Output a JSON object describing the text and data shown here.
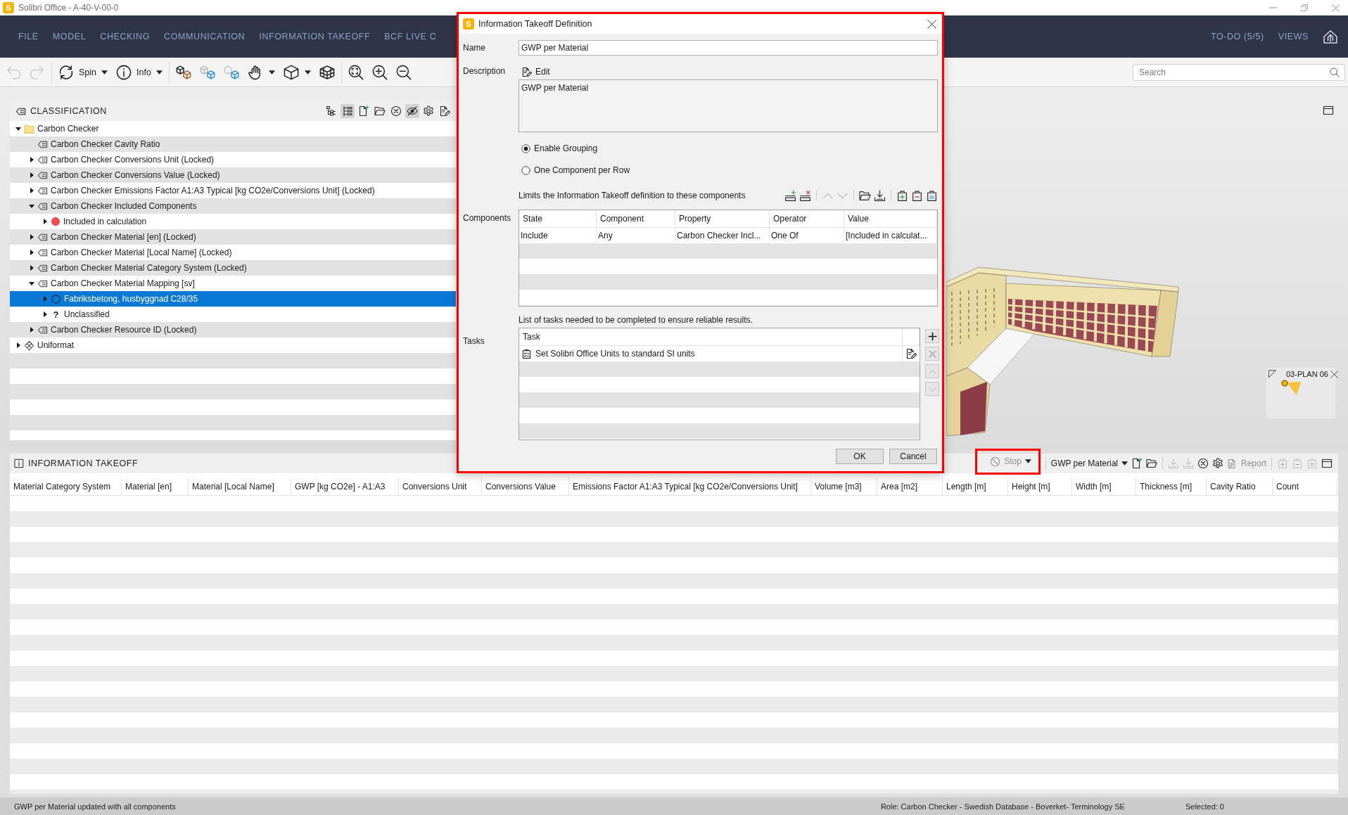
{
  "window": {
    "logo": "S",
    "title": "Solibri Office - A-40-V-00-0"
  },
  "menu": {
    "items": [
      "FILE",
      "MODEL",
      "CHECKING",
      "COMMUNICATION",
      "INFORMATION TAKEOFF",
      "BCF LIVE C"
    ],
    "right_items": [
      "TO-DO (5/5)",
      "VIEWS"
    ]
  },
  "toolbar": {
    "groups": [
      [
        {
          "kind": "undo",
          "disabled": true,
          "dropdown": false
        },
        {
          "kind": "redo",
          "disabled": true,
          "dropdown": false
        }
      ],
      [
        {
          "kind": "spin",
          "label": "Spin",
          "disabled": false,
          "dropdown": true
        },
        {
          "kind": "info",
          "label": "Info",
          "disabled": false,
          "dropdown": true
        }
      ],
      [
        {
          "kind": "components",
          "disabled": false,
          "dropdown": false
        },
        {
          "kind": "transparent",
          "disabled": false,
          "dropdown": false
        },
        {
          "kind": "hidden",
          "disabled": false,
          "dropdown": false
        },
        {
          "kind": "hand",
          "disabled": false,
          "dropdown": true
        },
        {
          "kind": "cube",
          "disabled": false,
          "dropdown": true
        },
        {
          "kind": "section",
          "disabled": false,
          "dropdown": false
        }
      ],
      [
        {
          "kind": "zoom-fit",
          "disabled": false,
          "dropdown": false
        },
        {
          "kind": "zoom-in",
          "disabled": false,
          "dropdown": false
        },
        {
          "kind": "zoom-out",
          "disabled": false,
          "dropdown": false
        }
      ]
    ],
    "search": {
      "placeholder": "Search"
    }
  },
  "classification": {
    "title": "CLASSIFICATION",
    "tools": [
      {
        "kind": "hierarchy",
        "pressed": false
      },
      {
        "kind": "tree",
        "pressed": true
      },
      {
        "kind": "new",
        "pressed": false
      },
      {
        "kind": "open",
        "pressed": false
      },
      {
        "kind": "clear",
        "pressed": false
      },
      {
        "kind": "hide",
        "pressed": true
      },
      {
        "kind": "settings",
        "pressed": false
      },
      {
        "kind": "edit",
        "pressed": false
      }
    ],
    "tree": [
      {
        "label": "Carbon Checker",
        "kind": "folder",
        "expanded": true,
        "selected": false,
        "children": [
          {
            "label": "Carbon Checker Cavity Ratio",
            "kind": "classification",
            "selected": false
          },
          {
            "label": "Carbon Checker Conversions Unit (Locked)",
            "kind": "classification",
            "expanded": false,
            "selected": false
          },
          {
            "label": "Carbon Checker Conversions Value (Locked)",
            "kind": "classification",
            "expanded": false,
            "selected": false
          },
          {
            "label": "Carbon Checker Emissions Factor A1:A3 Typical [kg CO2e/Conversions Unit] (Locked)",
            "kind": "classification",
            "expanded": false,
            "selected": false
          },
          {
            "label": "Carbon Checker Included Components",
            "kind": "classification",
            "expanded": true,
            "selected": false,
            "children": [
              {
                "label": "Included in calculation",
                "kind": "dot",
                "color": "#ee4d4d",
                "expanded": false,
                "selected": false
              }
            ]
          },
          {
            "label": "Carbon Checker Material [en] (Locked)",
            "kind": "classification",
            "expanded": false,
            "selected": false
          },
          {
            "label": "Carbon Checker Material [Local Name] (Locked)",
            "kind": "classification",
            "expanded": false,
            "selected": false
          },
          {
            "label": "Carbon Checker Material Category System (Locked)",
            "kind": "classification",
            "expanded": false,
            "selected": false
          },
          {
            "label": "Carbon Checker Material Mapping [sv]",
            "kind": "classification",
            "expanded": true,
            "selected": false,
            "children": [
              {
                "label": "Fabriksbetong, husbyggnad C28/35",
                "kind": "ring",
                "expanded": false,
                "selected": true
              },
              {
                "label": "Unclassified",
                "kind": "unknown",
                "symbol": "?",
                "expanded": false,
                "selected": false
              }
            ]
          },
          {
            "label": "Carbon Checker Resource ID (Locked)",
            "kind": "classification",
            "expanded": false,
            "selected": false
          }
        ]
      },
      {
        "label": "Uniformat",
        "kind": "standard",
        "expanded": false,
        "selected": false
      }
    ]
  },
  "model_view": {
    "plan": {
      "label": "03-PLAN 06"
    }
  },
  "takeoff": {
    "title": "INFORMATION TAKEOFF",
    "groups": [
      [
        {
          "kind": "stop",
          "label": "Stop",
          "dropdown": true,
          "disabled": true,
          "highlighted": true
        }
      ],
      [
        {
          "kind": "definition",
          "label": "GWP per Material",
          "dropdown": true,
          "disabled": false,
          "highlighted": false
        },
        {
          "kind": "new",
          "dropdown": false,
          "disabled": false,
          "highlighted": false
        },
        {
          "kind": "open",
          "dropdown": false,
          "disabled": false,
          "highlighted": false
        }
      ],
      [
        {
          "kind": "export",
          "dropdown": false,
          "disabled": true,
          "highlighted": false
        },
        {
          "kind": "export-all",
          "dropdown": false,
          "disabled": true,
          "highlighted": false
        },
        {
          "kind": "clear",
          "dropdown": false,
          "disabled": false,
          "highlighted": false
        },
        {
          "kind": "settings",
          "dropdown": false,
          "disabled": false,
          "highlighted": false
        },
        {
          "kind": "report",
          "label": "Report",
          "dropdown": false,
          "disabled": true,
          "highlighted": false
        }
      ],
      [
        {
          "kind": "clipboard-add",
          "dropdown": false,
          "disabled": true,
          "highlighted": false
        },
        {
          "kind": "clipboard-remove",
          "dropdown": false,
          "disabled": true,
          "highlighted": false
        },
        {
          "kind": "clipboard",
          "dropdown": false,
          "disabled": true,
          "highlighted": false
        },
        {
          "kind": "window",
          "dropdown": false,
          "disabled": false,
          "highlighted": false
        }
      ]
    ],
    "columns": [
      "Material Category System",
      "Material [en]",
      "Material [Local Name]",
      "GWP [kg CO2e] - A1:A3",
      "Conversions Unit",
      "Conversions Value",
      "Emissions Factor A1:A3 Typical [kg CO2e/Conversions Unit]",
      "Volume [m3]",
      "Area [m2]",
      "Length [m]",
      "Height [m]",
      "Width [m]",
      "Thickness [m]",
      "Cavity Ratio",
      "Count"
    ]
  },
  "dialog": {
    "logo": "S",
    "title": "Information Takeoff Definition",
    "highlighted": true,
    "name": {
      "label": "Name",
      "value": "GWP per Material"
    },
    "description": {
      "label": "Description",
      "edit": "Edit",
      "value": "GWP per Material"
    },
    "grouping": [
      {
        "label": "Enable Grouping",
        "selected": true
      },
      {
        "label": "One Component per Row",
        "selected": false
      }
    ],
    "components": {
      "label": "Components",
      "hint": "Limits the Information Takeoff definition to these components",
      "tools": [
        [
          {
            "kind": "add-row",
            "disabled": false
          },
          {
            "kind": "remove-row",
            "disabled": false
          }
        ],
        [
          {
            "kind": "up",
            "disabled": true
          },
          {
            "kind": "down",
            "disabled": true
          }
        ],
        [
          {
            "kind": "open",
            "disabled": false
          },
          {
            "kind": "export",
            "disabled": false
          }
        ],
        [
          {
            "kind": "clipboard-add",
            "disabled": false
          },
          {
            "kind": "clipboard-remove",
            "disabled": false
          },
          {
            "kind": "clipboard",
            "disabled": false
          }
        ]
      ],
      "columns": [
        "State",
        "Component",
        "Property",
        "Operator",
        "Value"
      ],
      "rows": [
        [
          "Include",
          "Any",
          "Carbon Checker Incl...",
          "One Of",
          "[Included in calculat..."
        ]
      ]
    },
    "tasks": {
      "label": "Tasks",
      "hint": "List of tasks needed to be completed to ensure reliable results.",
      "columns": [
        "Task"
      ],
      "rows": [
        {
          "text": "Set Solibri Office Units to standard SI units"
        }
      ],
      "tools": [
        {
          "kind": "add",
          "disabled": false
        },
        {
          "kind": "remove",
          "disabled": true
        },
        {
          "kind": "up",
          "disabled": true
        },
        {
          "kind": "down",
          "disabled": true
        }
      ]
    },
    "buttons": [
      {
        "label": "OK"
      },
      {
        "label": "Cancel"
      }
    ]
  },
  "status_bar": {
    "message": "GWP per Material updated with all components",
    "role": "Role: Carbon Checker - Swedish Database - Boverket- Terminology SE",
    "selection": "Selected: 0"
  }
}
